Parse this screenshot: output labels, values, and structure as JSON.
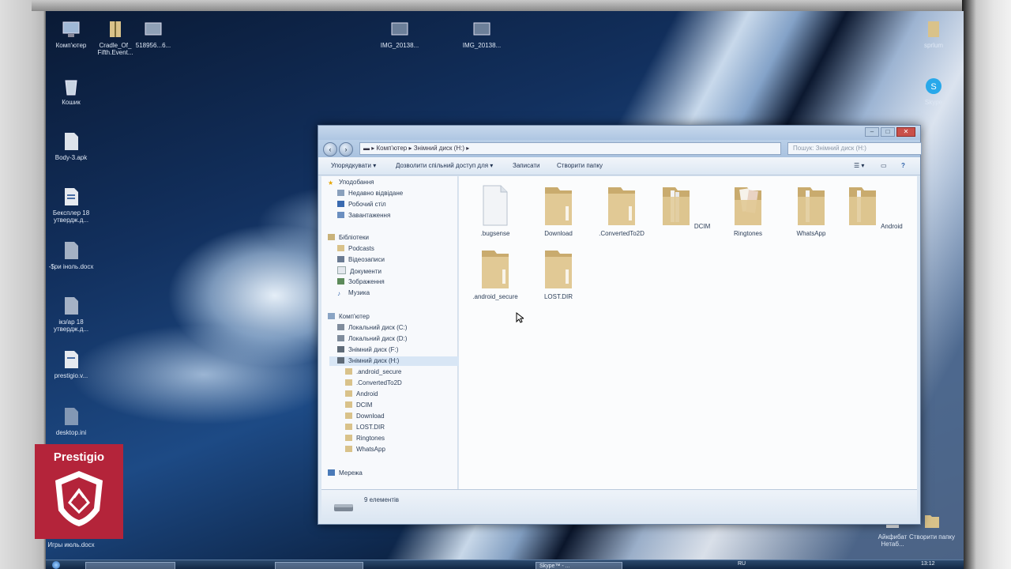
{
  "desktop": {
    "icons": [
      {
        "label": "Комп'ютер"
      },
      {
        "label": "Cradle_Of_ Fifth.Event..."
      },
      {
        "label": "518956...6..."
      },
      {
        "label": "IMG_20138..."
      },
      {
        "label": "IMG_20138..."
      },
      {
        "label": "Кошик"
      },
      {
        "label": "Body-3.apk"
      },
      {
        "label": "Бексплер 18 утвердж.д..."
      },
      {
        "label": "-$ри іноль.docx"
      },
      {
        "label": "ікз/ар 18 утвердж.д..."
      },
      {
        "label": "prestigio.v..."
      },
      {
        "label": "desktop.ini"
      },
      {
        "label": "Игры июль.docx"
      },
      {
        "label": "sprlum"
      },
      {
        "label": "Skype"
      },
      {
        "label": "Айкфибат Нетаб..."
      },
      {
        "label": "Створити папку"
      }
    ]
  },
  "window": {
    "address": {
      "path": [
        "Комп'ютер",
        "Знімний диск (H:)"
      ]
    },
    "search_placeholder": "Пошук: Знімний диск (H:)",
    "nav_back": "‹",
    "nav_forward": "›",
    "toolbar": {
      "organize": "Упорядкувати",
      "share": "Дозволити спільний доступ для",
      "burn": "Записати",
      "new_folder": "Створити папку"
    },
    "sidebar": {
      "favorites": {
        "header": "Уподобання",
        "items": [
          "Недавно відвідане",
          "Робочий стіл",
          "Завантаження"
        ]
      },
      "libraries": {
        "header": "Бібліотеки",
        "items": [
          "Podcasts",
          "Відеозаписи",
          "Документи",
          "Зображення",
          "Музика"
        ]
      },
      "computer": {
        "header": "Комп'ютер",
        "items": [
          "Локальний диск (C:)",
          "Локальний диск (D:)",
          "Знімний диск (F:)",
          "Знімний диск (H:)"
        ]
      },
      "subfolders": [
        ".android_secure",
        ".ConvertedTo2D",
        "Android",
        "DCIM",
        "Download",
        "LOST.DIR",
        "Ringtones",
        "WhatsApp"
      ],
      "network": {
        "header": "Мережа"
      }
    },
    "files": [
      {
        "name": ".bugsense",
        "kind": "file"
      },
      {
        "name": "Download",
        "kind": "folder"
      },
      {
        "name": ".ConvertedTo2D",
        "kind": "folder"
      },
      {
        "name": "DCIM",
        "kind": "folder-docs"
      },
      {
        "name": "Ringtones",
        "kind": "folder-pics"
      },
      {
        "name": "WhatsApp",
        "kind": "folder-docs"
      },
      {
        "name": "Android",
        "kind": "folder-docs"
      },
      {
        "name": ".android_secure",
        "kind": "folder"
      },
      {
        "name": "LOST.DIR",
        "kind": "folder"
      }
    ],
    "status": {
      "count": "9 елементів"
    }
  },
  "taskbar": {
    "items": [
      "",
      "",
      "Skype™ - ..."
    ],
    "lang": "RU",
    "clock": "13:12"
  },
  "overlay": {
    "brand": "Prestigio"
  },
  "colors": {
    "accent": "#b4243a",
    "folder": "#e1c995",
    "selection": "#d8e6f5"
  }
}
